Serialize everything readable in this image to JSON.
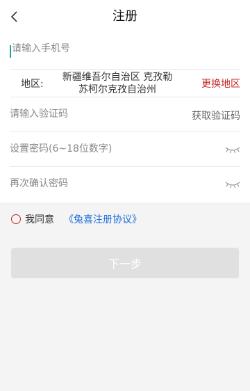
{
  "header": {
    "title": "注册",
    "back_icon": "chevron-left-icon"
  },
  "form": {
    "phone": {
      "placeholder": "请输入手机号",
      "value": ""
    },
    "region": {
      "label": "地区:",
      "value_line1": "新疆维吾尔自治区  克孜勒",
      "value_line2": "苏柯尔克孜自治州",
      "change_label": "更换地区"
    },
    "code": {
      "placeholder": "请输入验证码",
      "get_code_label": "获取验证码"
    },
    "password": {
      "placeholder": "设置密码(6~18位数字)",
      "toggle_icon": "eye-closed-icon"
    },
    "confirm_password": {
      "placeholder": "再次确认密码",
      "toggle_icon": "eye-closed-icon"
    }
  },
  "agreement": {
    "text": "我同意",
    "link": "《兔喜注册协议》",
    "checked": false
  },
  "next_button": {
    "label": "下一步",
    "enabled": false
  },
  "colors": {
    "accent_red": "#c62828",
    "link_blue": "#1e6fd9",
    "button_disabled": "#e0e0e0"
  }
}
